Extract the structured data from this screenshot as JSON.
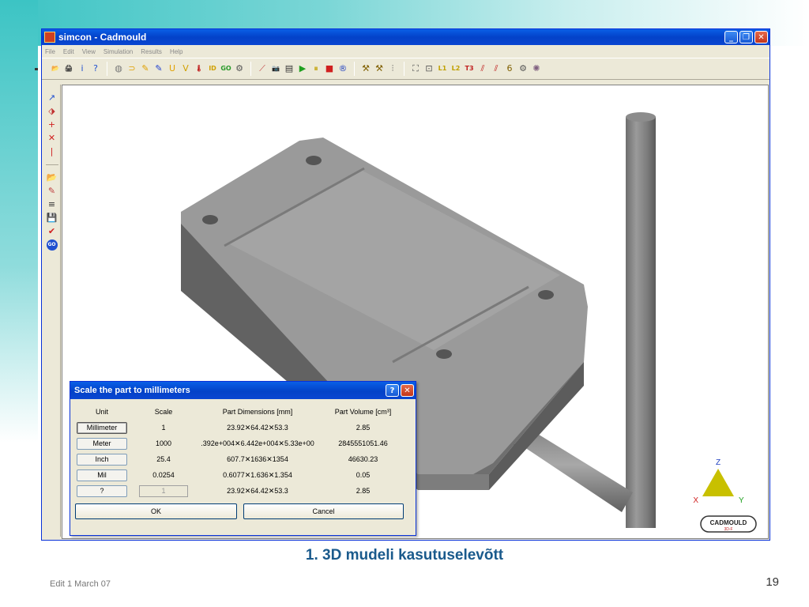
{
  "window": {
    "title": "simcon - Cadmould",
    "minimize": "_",
    "restore": "❐",
    "close": "✕"
  },
  "menu": [
    "File",
    "Edit",
    "View",
    "Simulation",
    "Results",
    "Help"
  ],
  "toolbar_icons": [
    "📂",
    "🖨",
    "i",
    "?",
    "|",
    "◍",
    "⊃",
    "✎",
    "✎",
    "U",
    "V",
    "🌡",
    "ID",
    "GO",
    "⚙",
    "|",
    "⟋",
    "📷",
    "▤",
    "▶",
    "⏸",
    "■",
    "®",
    "|",
    "⚒",
    "⚒",
    "⫶",
    "|",
    "⛶",
    "⊡",
    "L1",
    "L2",
    "T3",
    "⫽",
    "⫽",
    "6",
    "⚙",
    "✺"
  ],
  "left_toolbar_top": [
    "↗",
    "⬗",
    "+",
    "✕",
    "|"
  ],
  "left_toolbar_bottom": [
    "📂",
    "✎",
    "≡",
    "💾",
    "✔",
    "GO"
  ],
  "dialog": {
    "title": "Scale the part to millimeters",
    "help": "?",
    "close": "✕",
    "headers": {
      "unit": "Unit",
      "scale": "Scale",
      "dims": "Part Dimensions [mm]",
      "vol": "Part Volume [cm³]"
    },
    "rows": [
      {
        "unit": "Millimeter",
        "scale": "1",
        "dims": "23.92✕64.42✕53.3",
        "vol": "2.85"
      },
      {
        "unit": "Meter",
        "scale": "1000",
        "dims": ".392e+004✕6.442e+004✕5.33e+00",
        "vol": "2845551051.46"
      },
      {
        "unit": "Inch",
        "scale": "25.4",
        "dims": "607.7✕1636✕1354",
        "vol": "46630.23"
      },
      {
        "unit": "Mil",
        "scale": "0.0254",
        "dims": "0.6077✕1.636✕1.354",
        "vol": "0.05"
      },
      {
        "unit": "?",
        "scale": "1",
        "dims": "23.92✕64.42✕53.3",
        "vol": "2.85"
      }
    ],
    "ok": "OK",
    "cancel": "Cancel"
  },
  "axes": {
    "z": "Z",
    "x": "X",
    "y": "Y"
  },
  "logo": "CADMOULD",
  "logo_sub": "3D-F",
  "caption": "1. 3D mudeli kasutuselevõtt",
  "footer": "Edit 1 March 07",
  "page_number": "19",
  "colors": {
    "part": "#8a8a8a",
    "titlebar": "#0a46d1",
    "caption": "#1a5a8c"
  }
}
